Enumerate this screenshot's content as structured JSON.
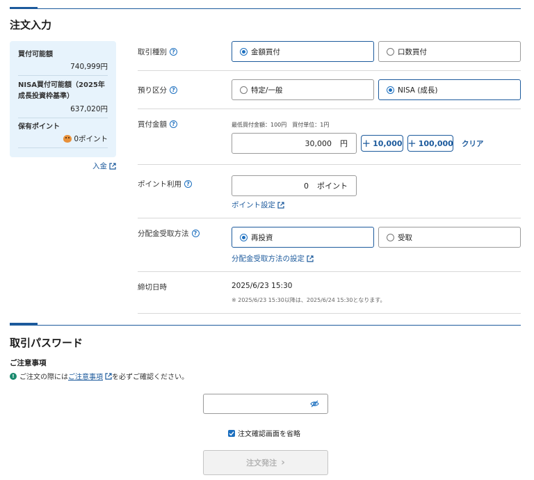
{
  "sections": {
    "order_title": "注文入力",
    "password_title": "取引パスワード"
  },
  "sidebar": {
    "buying_power_label": "買付可能額",
    "buying_power_value": "740,999円",
    "nisa_label_line1": "NISA買付可能額（2025年",
    "nisa_label_line2": "成長投資枠基準）",
    "nisa_value": "637,020円",
    "points_label": "保有ポイント",
    "points_value": "0ポイント",
    "deposit_link": "入金"
  },
  "trade_type": {
    "label": "取引種別",
    "options": [
      "金額買付",
      "口数買付"
    ],
    "selected": "金額買付"
  },
  "account_type": {
    "label": "預り区分",
    "options": [
      "特定/一般",
      "NISA (成長)"
    ],
    "selected": "NISA (成長)"
  },
  "amount": {
    "label": "買付金額",
    "hint": "最低買付金額：100円　買付単位：1円",
    "value": "30,000",
    "unit": "円",
    "add_10000": "10,000",
    "add_100000": "100,000",
    "clear": "クリア"
  },
  "points": {
    "label": "ポイント利用",
    "value": "0",
    "unit": "ポイント",
    "settings_link": "ポイント設定"
  },
  "dividend": {
    "label": "分配金受取方法",
    "options": [
      "再投資",
      "受取"
    ],
    "selected": "再投資",
    "settings_link": "分配金受取方法の設定"
  },
  "deadline": {
    "label": "締切日時",
    "value": "2025/6/23 15:30",
    "note": "※ 2025/6/23 15:30以降は、2025/6/24 15:30となります。"
  },
  "caution": {
    "heading": "ご注意事項",
    "text_before": "ご注文の際には",
    "link": "ご注意事項",
    "text_after": "を必ずご確認ください。"
  },
  "password": {
    "value": "",
    "placeholder": ""
  },
  "skip_confirm": {
    "label": "注文確認画面を省略",
    "checked": true
  },
  "submit": {
    "label": "注文発注",
    "enabled": false
  },
  "colors": {
    "accent": "#1c5a9c",
    "sidebar_bg": "#e7f3fc",
    "caution_icon": "#1a8a6e"
  }
}
